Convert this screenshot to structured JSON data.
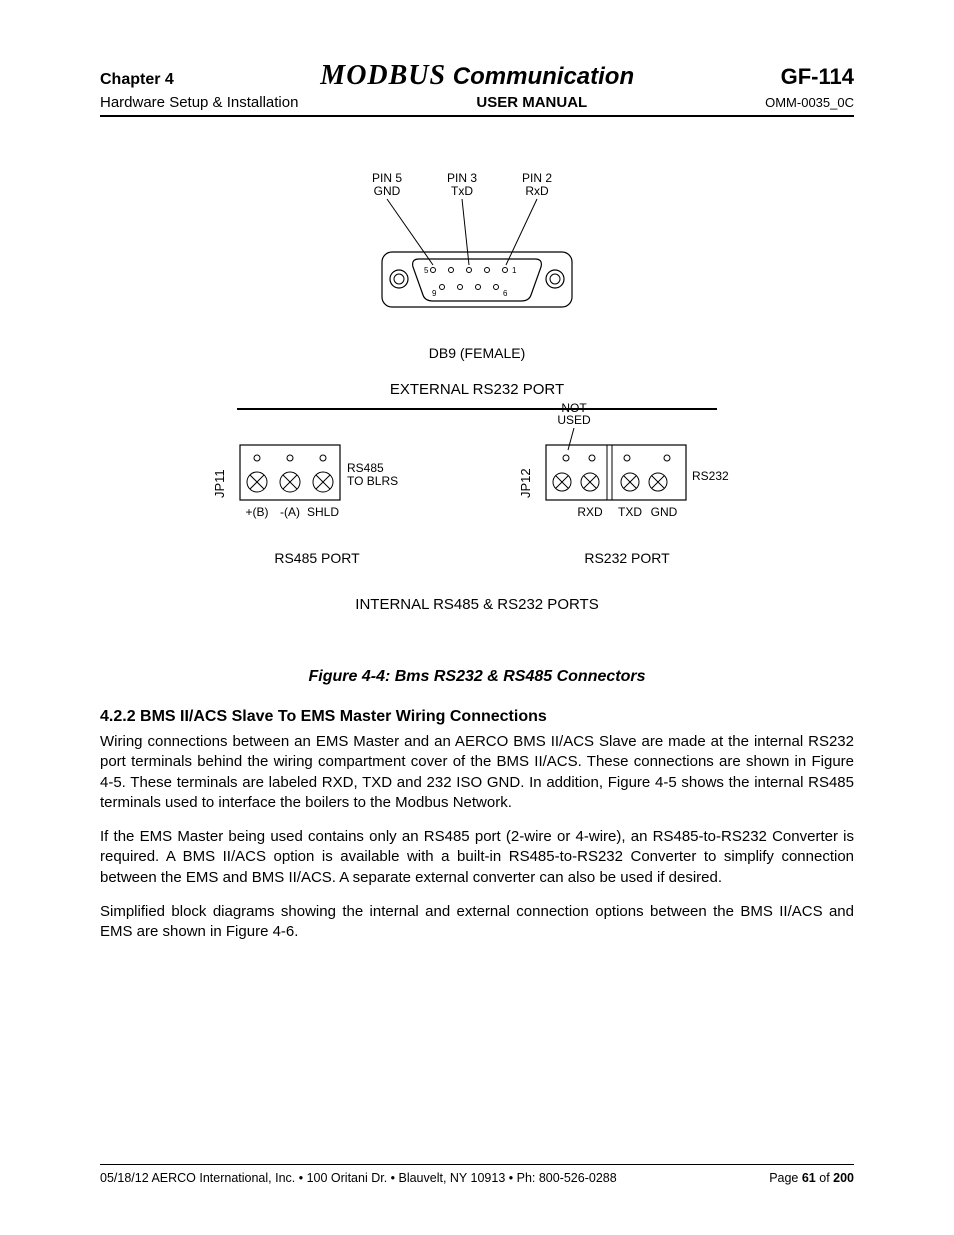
{
  "header": {
    "chapter": "Chapter 4",
    "title_modbus": "MODBUS",
    "title_rest": " Communication",
    "gf": "GF-114",
    "hw": "Hardware Setup & Installation",
    "usermanual": "USER MANUAL",
    "omm": "OMM-0035_0C"
  },
  "db9": {
    "pin5a": "PIN 5",
    "pin5b": "GND",
    "pin3a": "PIN 3",
    "pin3b": "TxD",
    "pin2a": "PIN 2",
    "pin2b": "RxD",
    "num5": "5",
    "num1": "1",
    "num9": "9",
    "num6": "6",
    "caption": "DB9 (FEMALE)",
    "ext": "EXTERNAL RS232 PORT"
  },
  "rs485": {
    "jp": "JP11",
    "side": "RS485\nTO BLRS",
    "b": "+(B)",
    "a": "-(A)",
    "shld": "SHLD",
    "caption": "RS485 PORT"
  },
  "rs232": {
    "notused": "NOT\nUSED",
    "jp": "JP12",
    "side": "RS232",
    "rxd": "RXD",
    "txd": "TXD",
    "gnd": "GND",
    "caption": "RS232 PORT"
  },
  "internal_caption": "INTERNAL RS485 & RS232 PORTS",
  "figure_title": "Figure 4-4:  Bms RS232 & RS485 Connectors",
  "section_heading": "4.2.2  BMS II/ACS Slave To EMS Master Wiring Connections",
  "para1": "Wiring connections between an EMS Master and an AERCO BMS II/ACS Slave are made at the internal RS232 port terminals behind the wiring compartment cover of the BMS II/ACS.  These connections are shown in Figure 4-5.  These terminals are labeled RXD, TXD and 232 ISO GND.  In addition, Figure 4-5 shows the internal RS485 terminals used to interface the boilers to the Modbus Network.",
  "para2": "If the EMS Master being used contains only an RS485 port (2-wire or 4-wire), an RS485-to-RS232 Converter is required.  A BMS II/ACS option is available with a built-in RS485-to-RS232 Converter to simplify connection between the EMS and BMS II/ACS.  A separate external converter can also be used if desired.",
  "para3": "Simplified block diagrams showing the internal and external connection options between the BMS II/ACS and EMS are shown in Figure 4-6.",
  "footer": {
    "left": "05/18/12  AERCO International, Inc. • 100 Oritani Dr. •  Blauvelt, NY 10913 • Ph: 800-526-0288",
    "page_label": "Page ",
    "page_num": "61",
    "of": " of ",
    "total": "200"
  }
}
